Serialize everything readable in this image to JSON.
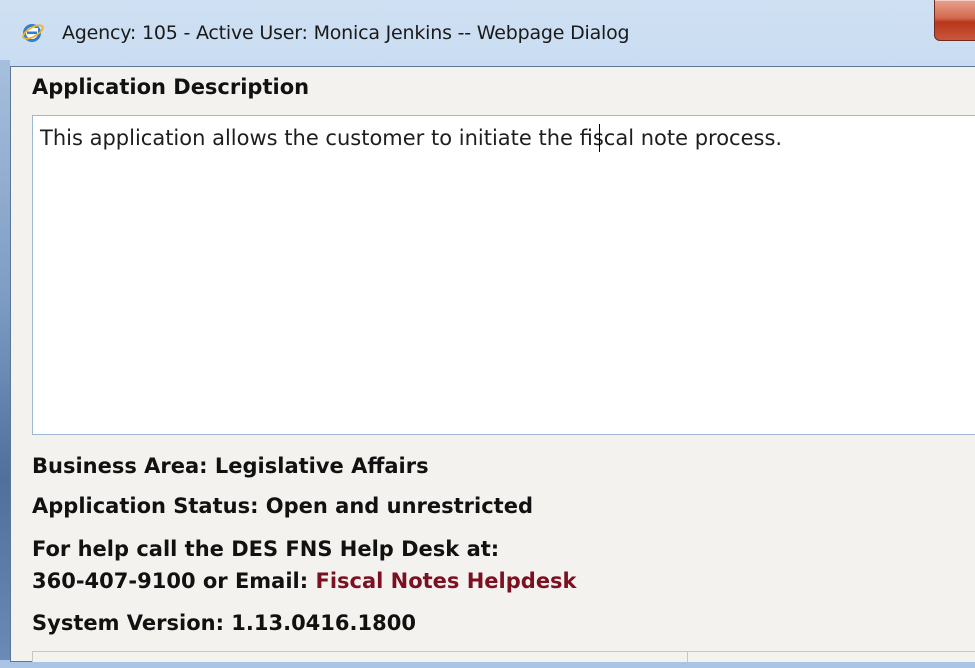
{
  "window": {
    "title": "Agency: 105 - Active User: Monica Jenkins -- Webpage Dialog",
    "icon": "internet-explorer-icon",
    "close_icon": "close-icon"
  },
  "dialog": {
    "heading": "Application Description",
    "description": "This application allows the customer to initiate the fiscal note process.",
    "business_area": "Business Area: Legislative Affairs",
    "application_status": "Application Status: Open and unrestricted",
    "help_line1": "For help call the DES FNS Help Desk at:",
    "help_phone_prefix": "360-407-9100 or Email: ",
    "help_link": "Fiscal Notes Helpdesk",
    "system_version": "System Version: 1.13.0416.1800"
  },
  "colors": {
    "link": "#7b1020",
    "client_bg": "#f3f2ee",
    "titlebar": "#c4d8ef"
  }
}
